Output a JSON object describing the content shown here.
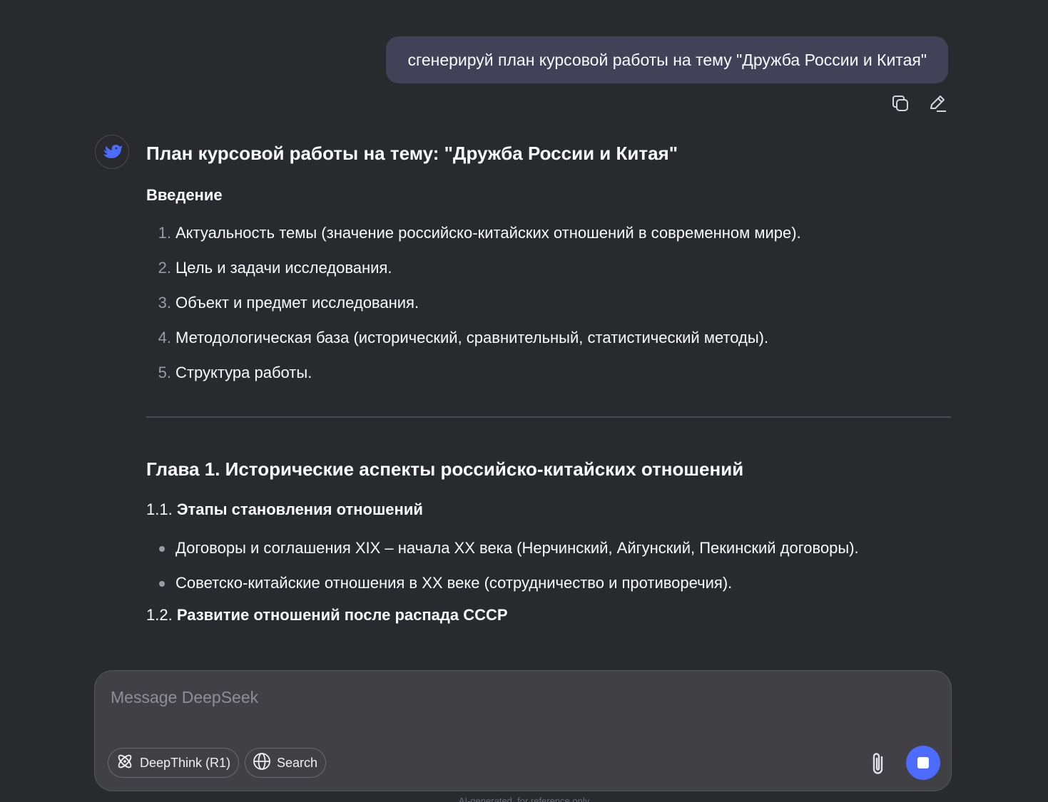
{
  "conversation": {
    "user_message": "сгенерируй план курсовой работы на тему \"Дружба России и Китая\"",
    "user_actions": {
      "copy_icon": "copy-icon",
      "edit_icon": "edit-icon"
    },
    "assistant": {
      "avatar_icon": "deepseek-whale-icon",
      "title": "План курсовой работы на тему: \"Дружба России и Китая\"",
      "intro_heading": "Введение",
      "intro_items": [
        {
          "num": "1.",
          "text": "Актуальность темы (значение российско-китайских отношений в современном мире)."
        },
        {
          "num": "2.",
          "text": "Цель и задачи исследования."
        },
        {
          "num": "3.",
          "text": "Объект и предмет исследования."
        },
        {
          "num": "4.",
          "text": "Методологическая база (исторический, сравнительный, статистический методы)."
        },
        {
          "num": "5.",
          "text": "Структура работы."
        }
      ],
      "chapter1_title": "Глава 1. Исторические аспекты российско-китайских отношений",
      "section_1_1": {
        "num": "1.1.",
        "title": "Этапы становления отношений"
      },
      "section_1_1_items": [
        "Договоры и соглашения XIX – начала XX века (Нерчинский, Айгунский, Пекинский договоры).",
        "Советско-китайские отношения в XX веке (сотрудничество и противоречия)."
      ],
      "section_1_2": {
        "num": "1.2.",
        "title": "Развитие отношений после распада СССР"
      }
    }
  },
  "composer": {
    "placeholder": "Message DeepSeek",
    "deepthink_label": "DeepThink (R1)",
    "deepthink_icon": "atom-icon",
    "search_label": "Search",
    "search_icon": "globe-icon",
    "attach_icon": "paperclip-icon",
    "stop_icon": "stop-icon",
    "accent_color": "#4d6bfe"
  },
  "footer": {
    "note": "AI-generated, for reference only"
  }
}
